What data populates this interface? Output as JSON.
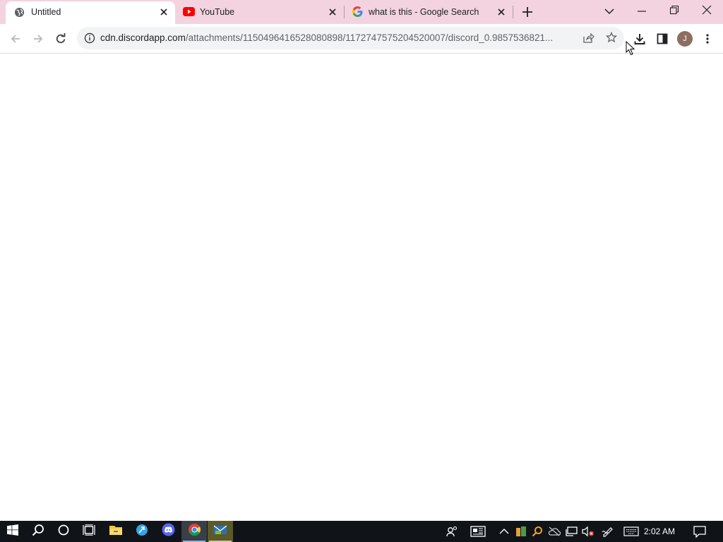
{
  "browser": {
    "tabs": [
      {
        "title": "Untitled",
        "icon": "globe-icon",
        "active": true
      },
      {
        "title": "YouTube",
        "icon": "youtube-icon",
        "active": false
      },
      {
        "title": "what is this - Google Search",
        "icon": "google-icon",
        "active": false
      }
    ],
    "address": {
      "host": "cdn.discordapp.com",
      "path": "/attachments/1150496416528080898/1172747575204520007/discord_0.9857536821..."
    },
    "profile_initial": "J",
    "accent_color": "#f3d3e0"
  },
  "taskbar": {
    "clock": "2:02 AM",
    "pinned": [
      "start-icon",
      "search-icon",
      "cortana-icon",
      "task-view-icon",
      "file-explorer-icon",
      "browser-icon",
      "discord-icon",
      "chrome-icon",
      "mail-app-icon"
    ]
  }
}
